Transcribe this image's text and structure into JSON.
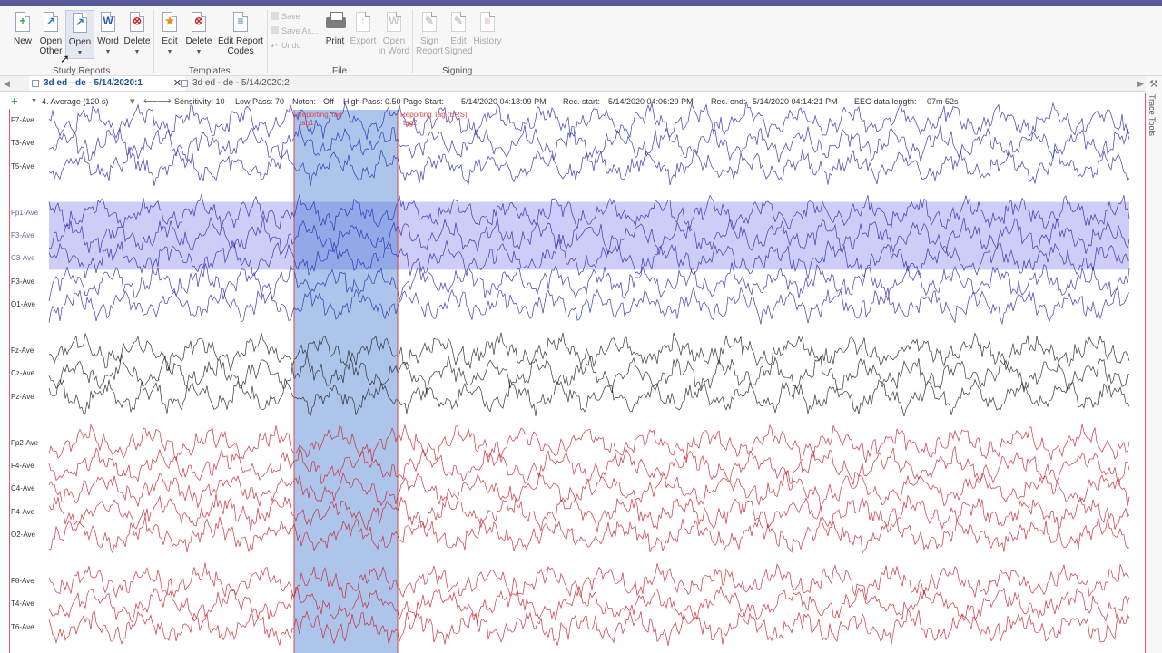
{
  "ribbon": {
    "study_reports": {
      "label": "Study Reports",
      "new": "New",
      "open_other_1": "Open",
      "open_other_2": "Other",
      "open": "Open",
      "word": "Word",
      "delete": "Delete"
    },
    "templates": {
      "label": "Templates",
      "edit": "Edit",
      "delete": "Delete",
      "edit_codes_1": "Edit Report",
      "edit_codes_2": "Codes"
    },
    "file": {
      "label": "File",
      "save": "Save",
      "save_as": "Save As...",
      "undo": "Undo",
      "print": "Print",
      "export": "Export",
      "open_in_word_1": "Open",
      "open_in_word_2": "in Word"
    },
    "signing": {
      "label": "Signing",
      "sign_1": "Sign",
      "sign_2": "Report",
      "edit_1": "Edit",
      "edit_2": "Signed",
      "history": "History"
    }
  },
  "tabs": [
    {
      "label": "3d ed - de - 5/14/2020:1",
      "active": true
    },
    {
      "label": "3d ed - de - 5/14/2020:2",
      "active": false
    }
  ],
  "infobar": {
    "montage": "4. Average (120 s)",
    "sensitivity": "Sensitivity: 10",
    "low_pass": "Low Pass: 70",
    "notch": "Notch:",
    "notch_value": "Off",
    "high_pass": "High Pass: 0.50",
    "page_start_label": "Page Start:",
    "page_start": "5/14/2020 04:13:09 PM",
    "rec_start_label": "Rec. start:",
    "rec_start": "5/14/2020 04:06:29 PM",
    "rec_end_label": "Rec. end:",
    "rec_end": "5/14/2020 04:14:21 PM",
    "length_label": "EEG data length:",
    "length": "07m 52s"
  },
  "annotations": [
    {
      "line1": "Reporting Tag",
      "line2": "tag1"
    },
    {
      "line1": "Reporting Tag (ERS)",
      "line2": "tag2"
    }
  ],
  "side_panel": {
    "label": "Trace Tools"
  },
  "colors": {
    "left_hemisphere": "#2a2ab0",
    "midline": "#222222",
    "right_hemisphere": "#c8202c",
    "selection": "#9c9cf0",
    "tag_band": "#4a7fd0",
    "title_bar": "#5b5a9c"
  },
  "channels": [
    {
      "label": "F7-Ave",
      "group": "left",
      "selected": false
    },
    {
      "label": "T3-Ave",
      "group": "left",
      "selected": false
    },
    {
      "label": "T5-Ave",
      "group": "left",
      "selected": false
    },
    {
      "label": "",
      "group": "gap",
      "selected": false
    },
    {
      "label": "Fp1-Ave",
      "group": "left",
      "selected": true
    },
    {
      "label": "F3-Ave",
      "group": "left",
      "selected": true
    },
    {
      "label": "C3-Ave",
      "group": "left",
      "selected": true
    },
    {
      "label": "P3-Ave",
      "group": "left",
      "selected": false
    },
    {
      "label": "O1-Ave",
      "group": "left",
      "selected": false
    },
    {
      "label": "",
      "group": "gap",
      "selected": false
    },
    {
      "label": "Fz-Ave",
      "group": "mid",
      "selected": false
    },
    {
      "label": "Cz-Ave",
      "group": "mid",
      "selected": false
    },
    {
      "label": "Pz-Ave",
      "group": "mid",
      "selected": false
    },
    {
      "label": "",
      "group": "gap",
      "selected": false
    },
    {
      "label": "Fp2-Ave",
      "group": "right",
      "selected": false
    },
    {
      "label": "F4-Ave",
      "group": "right",
      "selected": false
    },
    {
      "label": "C4-Ave",
      "group": "right",
      "selected": false
    },
    {
      "label": "P4-Ave",
      "group": "right",
      "selected": false
    },
    {
      "label": "O2-Ave",
      "group": "right",
      "selected": false
    },
    {
      "label": "",
      "group": "gap",
      "selected": false
    },
    {
      "label": "F8-Ave",
      "group": "right",
      "selected": false
    },
    {
      "label": "T4-Ave",
      "group": "right",
      "selected": false
    },
    {
      "label": "T6-Ave",
      "group": "right",
      "selected": false
    }
  ]
}
